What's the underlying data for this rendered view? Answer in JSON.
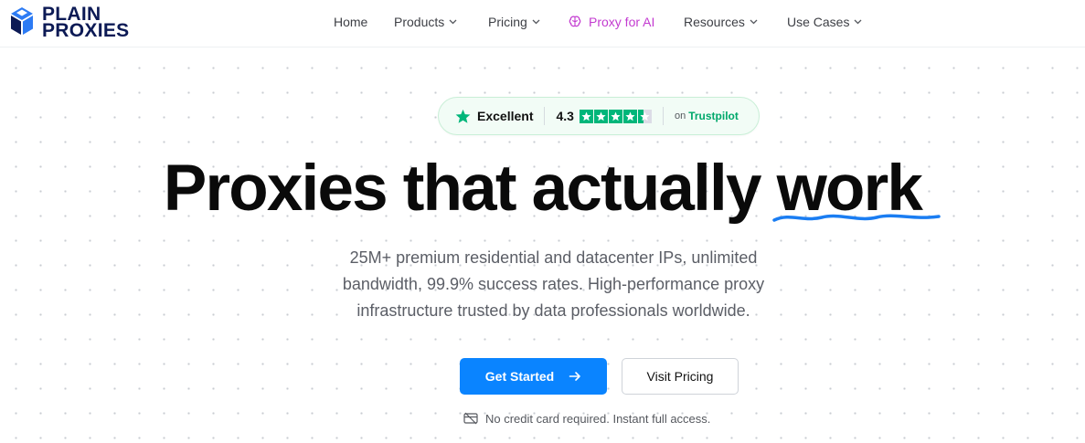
{
  "brand": {
    "line1": "PLAIN",
    "line2": "PROXIES",
    "color": "#0c1a55",
    "accent": "#2d7bf4"
  },
  "nav": {
    "home": "Home",
    "products": "Products",
    "pricing": "Pricing",
    "proxy_ai": "Proxy for AI",
    "resources": "Resources",
    "use_cases": "Use Cases"
  },
  "trustpilot": {
    "rating_word": "Excellent",
    "score": "4.3",
    "on": "on",
    "brand": "Trustpilot",
    "stars_filled": 4.4,
    "stars_total": 5,
    "color": "#00b67a"
  },
  "hero": {
    "headline_main": "Proxies that actually",
    "headline_emph": "work",
    "subtitle": "25M+ premium residential and datacenter IPs, unlimited bandwidth, 99.9% success rates. High-performance proxy infrastructure trusted by data professionals worldwide.",
    "cta_primary": "Get Started",
    "cta_secondary": "Visit Pricing",
    "note": "No credit card required. Instant full access.",
    "primary_color": "#0a84ff"
  }
}
